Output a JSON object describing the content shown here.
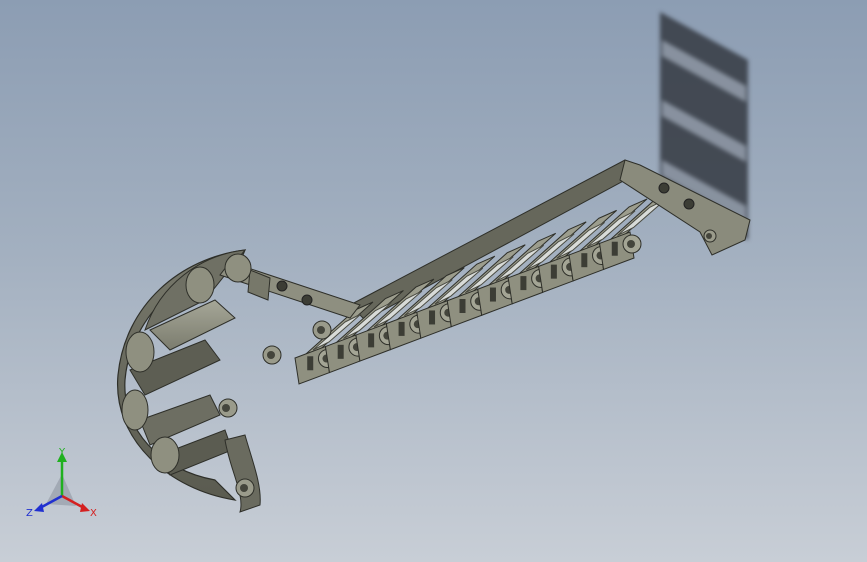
{
  "viewport": {
    "model_name": "",
    "part_type": "cable drag chain",
    "link_count_lower": 11,
    "background_top_color": "#8c9db3",
    "background_bottom_color": "#c8ced6",
    "chain_color": "#8f9080",
    "chain_dark_color": "#4a4b42",
    "chain_light_color": "#a9aa9a"
  },
  "triad": {
    "x_label": "X",
    "y_label": "Y",
    "z_label": "Z",
    "x_color": "#d42020",
    "y_color": "#20b020",
    "z_color": "#2030d0"
  }
}
